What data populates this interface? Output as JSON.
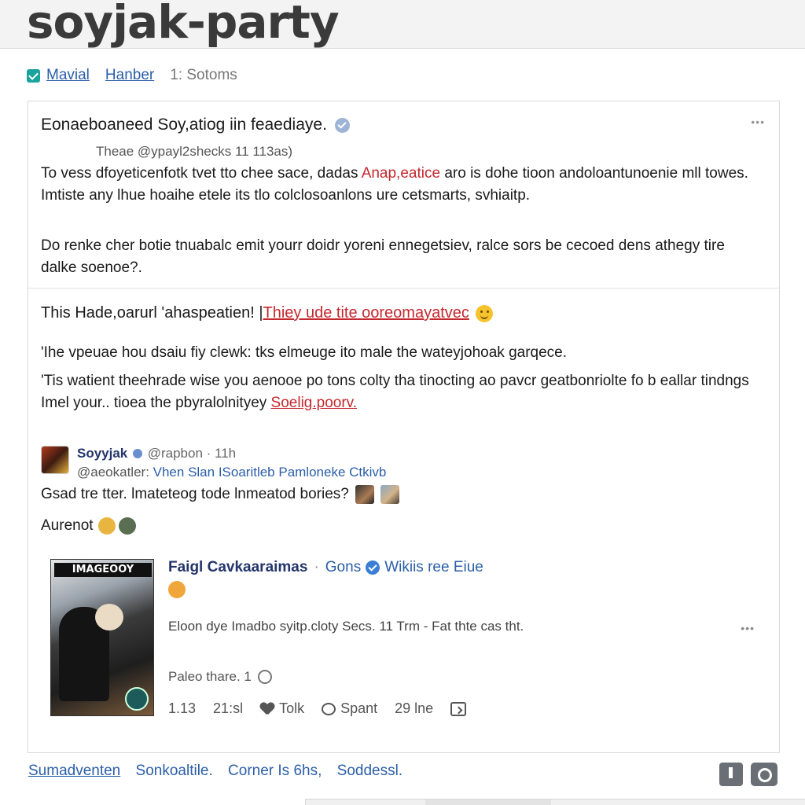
{
  "header": {
    "site_title": "soyjak-party"
  },
  "subnav": {
    "links": [
      "Mavial",
      "Hanber"
    ],
    "muted": "1: Sotoms"
  },
  "post": {
    "title": "Eonaeboaneed Soy,atiog iin feaediaye.",
    "meta": "Theae @ypayl2shecks 11 113as)",
    "para1_a": "To vess dfoyeticenfotk tvet tto chee sace, dadas ",
    "para1_red": "Anap,eatice",
    "para1_b": " aro is dohe tioon andoloantunoenie mll towes. Imtiste any lhue hoaihe etele its tlo colclosoanlons ure cetsmarts, svhiaitp.",
    "para2": "Do renke cher botie tnuabalc emit yourr doidr yoreni ennegetsiev, ralce sors be cecoed dens athegy tire dalke soenoe?."
  },
  "section": {
    "title_a": "This Hade,oarurl 'ahaspeatien! | ",
    "title_red": "Thiey ude tite ooreomayatvec",
    "line1": "'Ihe vpeuae hou dsaiu fiy clewk: tks elmeuge ito male the wateyjohoak garqece.",
    "line2_a": "'Tis watient theehrade wise you aenooe po tons colty tha tinocting ao pavcr geatbonriolte fo b eallar tindngs Imel your.. tioea the pbyralolnityey ",
    "line2_link": "Soelig.poorv."
  },
  "reply": {
    "name": "Soyyjak",
    "handle": "@rapbon · 11h",
    "sub_handle": "@aeokatler: ",
    "sub_text": "Vhen Slan ISoaritleb Pamloneke Ctkivb",
    "text": "Gsad tre tter. lmateteog tode lnmeatod bories?",
    "foot": "Aurenot"
  },
  "embed": {
    "poster_title": "IMAGEOOY",
    "name": "Faigl Cavkaaraimas",
    "sep": "·",
    "meta_a": "Gons",
    "meta_b": "Wikiis ree Eiue",
    "text": "Eloon dye Imadbo syitp.cloty Secs. 11 Trm - Fat thte cas tht.",
    "place": "Paleo thare. 1",
    "actions": [
      "1.13",
      "21:sl",
      "Tolk",
      "Spant",
      "29 lne"
    ]
  },
  "footer": {
    "links": [
      "Sumadventen",
      "Sonkoaltile.",
      "Corner Is 6hs,",
      "Soddessl."
    ]
  },
  "colors": {
    "link_blue": "#2b5ea8",
    "name_navy": "#24356b",
    "accent_red": "#c4282e",
    "check_teal": "#1aa39c"
  },
  "icons": [
    "check-icon",
    "verified-icon",
    "more-icon",
    "emoji-icon",
    "globe-icon",
    "heart-icon",
    "bubble-icon",
    "share-icon",
    "flag-icon",
    "camera-icon"
  ]
}
